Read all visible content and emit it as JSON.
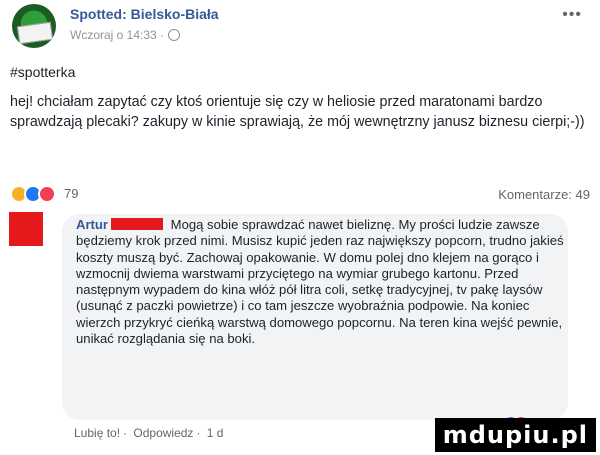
{
  "post": {
    "page_name": "Spotted: Bielsko-Biała",
    "time": "Wczoraj o 14:33 ·",
    "hashtag": "#spotterka",
    "text": "hej! chciałam zapytać czy ktoś orientuje się czy w heliosie przed maratonami bardzo sprawdzają plecaki? zakupy w kinie sprawiają, że mój wewnętrzny janusz biznesu cierpi;-))",
    "reaction_count": "79",
    "comments_label": "Komentarze: 49"
  },
  "comment": {
    "author": "Artur",
    "text": "Mogą sobie sprawdzać nawet bieliznę. My prości ludzie zawsze będziemy krok przed nimi. Musisz kupić jeden raz największy popcorn, trudno jakieś koszty muszą być. Zachowaj opakowanie. W domu polej dno klejem na gorąco i wzmocnij dwiema warstwami przyciętego na wymiar grubego kartonu. Przed następnym wypadem do kina włóż pół litra coli, setkę tradycyjnej, tv pakę laysów (usunąć z paczki powietrze) i co tam jeszcze wyobraźnia podpowie. Na koniec wierzch przykryć cieńką warstwą domowego popcornu. Na teren kina wejść pewnie, unikać rozglądania się na boki.",
    "like": "Lubię to!",
    "reply": "Odpowiedz",
    "age": "1 d"
  },
  "watermark": "mdupiu.pl",
  "colors": {
    "link": "#365899",
    "redaction": "#e3191b",
    "bubble": "#f2f3f5"
  }
}
